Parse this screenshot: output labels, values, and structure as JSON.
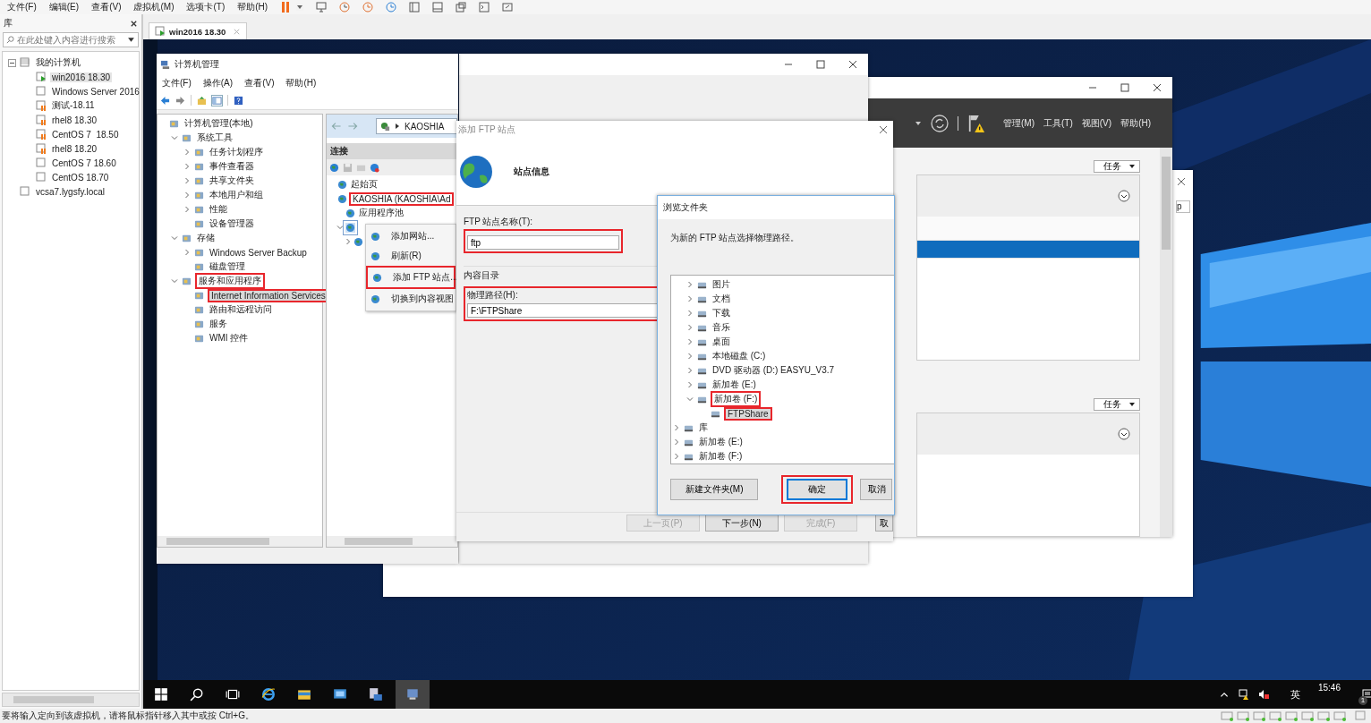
{
  "vmware": {
    "menu": [
      "文件(F)",
      "编辑(E)",
      "查看(V)",
      "虚拟机(M)",
      "选项卡(T)",
      "帮助(H)"
    ]
  },
  "library": {
    "title": "库",
    "search": {
      "placeholder": "在此处键入内容进行搜索"
    },
    "tree": [
      {
        "label": "我的计算机",
        "kind": "computer",
        "expanded": true,
        "selected": false,
        "children": [
          {
            "label": "win2016 18.30",
            "kind": "running",
            "selected": true
          },
          {
            "label": "Windows Server 2016",
            "kind": "off",
            "selected": false
          },
          {
            "label": "测试-18.11",
            "kind": "paused",
            "selected": false
          },
          {
            "label": "rhel8 18.30",
            "kind": "paused",
            "selected": false
          },
          {
            "label": "CentOS 7  18.50",
            "kind": "paused",
            "selected": false
          },
          {
            "label": "rhel8 18.20",
            "kind": "paused",
            "selected": false
          },
          {
            "label": "CentOS 7 18.60",
            "kind": "off",
            "selected": false
          },
          {
            "label": "CentOS 18.70",
            "kind": "off",
            "selected": false
          }
        ]
      },
      {
        "label": "vcsa7.lygsfy.local",
        "kind": "host",
        "selected": false
      }
    ]
  },
  "tabs": [
    {
      "label": "win2016 18.30",
      "selected": true
    }
  ],
  "computer_management": {
    "title": "计算机管理",
    "menu": [
      "文件(F)",
      "操作(A)",
      "查看(V)",
      "帮助(H)"
    ],
    "tree": [
      {
        "label": "计算机管理(本地)",
        "kind": "leaf",
        "selected": false,
        "children": [
          {
            "label": "系统工具",
            "kind": "open",
            "selected": false,
            "children": [
              {
                "label": "任务计划程序",
                "kind": "closed",
                "selected": false
              },
              {
                "label": "事件查看器",
                "kind": "closed",
                "selected": false
              },
              {
                "label": "共享文件夹",
                "kind": "closed",
                "selected": false
              },
              {
                "label": "本地用户和组",
                "kind": "closed",
                "selected": false
              },
              {
                "label": "性能",
                "kind": "closed",
                "selected": false
              },
              {
                "label": "设备管理器",
                "kind": "leaf",
                "selected": false
              }
            ]
          },
          {
            "label": "存储",
            "kind": "open",
            "selected": false,
            "children": [
              {
                "label": "Windows Server Backup",
                "kind": "closed",
                "selected": false
              },
              {
                "label": "磁盘管理",
                "kind": "leaf",
                "selected": false
              }
            ]
          },
          {
            "label": "服务和应用程序",
            "kind": "open",
            "selected": false,
            "children": [
              {
                "label": "Internet Information Services",
                "kind": "leaf",
                "selected": true
              },
              {
                "label": "路由和远程访问",
                "kind": "leaf",
                "selected": false
              },
              {
                "label": "服务",
                "kind": "leaf",
                "selected": false
              },
              {
                "label": "WMI 控件",
                "kind": "leaf",
                "selected": false
              }
            ]
          }
        ]
      }
    ],
    "iis": {
      "breadcrumb": "KAOSHIA",
      "connections_title": "连接",
      "tree": [
        {
          "label": "起始页",
          "kind": "leaf",
          "selected": false
        },
        {
          "label": "KAOSHIA (KAOSHIA\\Ad",
          "kind": "leaf",
          "selected": false,
          "children": [
            {
              "label": "应用程序池",
              "kind": "leaf",
              "selected": false
            },
            {
              "kind": "open",
              "selected": true,
              "children": [
                {
                  "kind": "closed",
                  "selected": false
                }
              ]
            }
          ]
        }
      ],
      "context_menu": [
        {
          "label": "添加网站..."
        },
        {
          "label": "刷新(R)"
        },
        {
          "label": "添加 FTP 站点..."
        },
        {
          "label": "切换到内容视图"
        }
      ]
    }
  },
  "server_manager": {
    "menu": [
      "管理(M)",
      "工具(T)",
      "视图(V)",
      "帮助(H)"
    ],
    "tasks": [
      "任务",
      "任务"
    ],
    "rows": [
      {
        "selected": false
      },
      {
        "selected": true
      }
    ]
  },
  "back_window": {
    "fragment": "p"
  },
  "ftp_dialog": {
    "title": "添加 FTP 站点",
    "heading": "站点信息",
    "name_label": "FTP 站点名称(T):",
    "name_value": "ftp",
    "group_label": "内容目录",
    "path_label": "物理路径(H):",
    "path_value": "F:\\FTPShare",
    "buttons": [
      {
        "label": "上一页(P)",
        "disabled": true
      },
      {
        "label": "下一步(N)",
        "disabled": false
      },
      {
        "label": "完成(F)",
        "disabled": true
      },
      {
        "label": "取",
        "disabled": false
      }
    ]
  },
  "browse_dialog": {
    "title": "浏览文件夹",
    "instruction": "为新的 FTP 站点选择物理路径。",
    "tree": [
      {
        "children": [
          {
            "label": "图片",
            "kind": "closed",
            "selected": false
          },
          {
            "label": "文档",
            "kind": "closed",
            "selected": false
          },
          {
            "label": "下载",
            "kind": "closed",
            "selected": false
          },
          {
            "label": "音乐",
            "kind": "closed",
            "selected": false
          },
          {
            "label": "桌面",
            "kind": "closed",
            "selected": false
          },
          {
            "label": "本地磁盘 (C:)",
            "kind": "closed",
            "selected": false
          },
          {
            "label": "DVD 驱动器 (D:) EASYU_V3.7",
            "kind": "closed",
            "selected": false
          },
          {
            "label": "新加卷 (E:)",
            "kind": "closed",
            "selected": false
          },
          {
            "label": "新加卷 (F:)",
            "kind": "open",
            "selected": false,
            "children": [
              {
                "label": "FTPShare",
                "kind": "leaf",
                "selected": true
              }
            ]
          }
        ]
      },
      {
        "label": "库",
        "kind": "closed",
        "selected": false
      },
      {
        "label": "新加卷 (E:)",
        "kind": "closed",
        "selected": false
      },
      {
        "label": "新加卷 (F:)",
        "kind": "closed",
        "selected": false
      }
    ],
    "buttons": [
      {
        "label": "新建文件夹(M)",
        "default": false
      },
      {
        "label": "确定",
        "default": true
      },
      {
        "label": "取消",
        "default": false
      }
    ]
  },
  "taskbar": {
    "ime": "英",
    "time": "15:46",
    "notification_count": "1"
  },
  "status_bar": {
    "text": "要将输入定向到该虚拟机，请将鼠标指针移入其中或按 Ctrl+G。"
  }
}
